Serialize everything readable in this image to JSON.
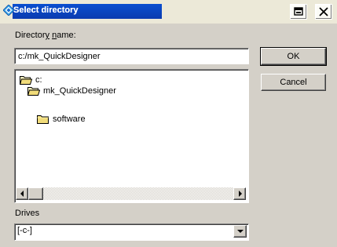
{
  "window": {
    "title": "Select directory",
    "title_icon": "app-diamond-icon",
    "title_color": "#0a44c4"
  },
  "directory_name": {
    "label_pre": "Director",
    "label_accel": "y",
    "label_post": " ",
    "label_accel2": "n",
    "label_rest": "ame:",
    "value": "c:/mk_QuickDesigner"
  },
  "buttons": {
    "ok": "OK",
    "cancel": "Cancel"
  },
  "tree": {
    "items": [
      {
        "label": "c:",
        "icon": "open-folder-icon"
      },
      {
        "label": "mk_QuickDesigner",
        "icon": "open-folder-icon"
      },
      {
        "label": "software",
        "icon": "closed-folder-icon"
      }
    ]
  },
  "drives": {
    "label": "Drives",
    "selected": "[-c-]"
  },
  "titlebar_buttons": {
    "help_icon": "context-help-icon",
    "close_icon": "close-icon"
  }
}
